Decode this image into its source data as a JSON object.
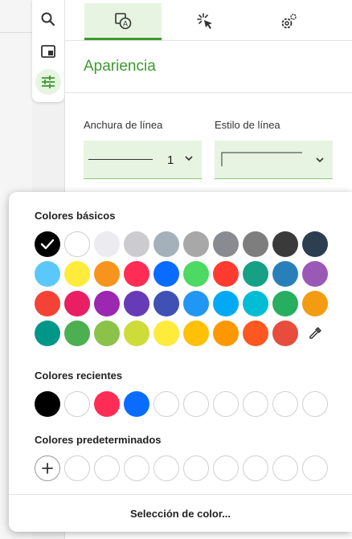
{
  "tabs": [
    {
      "name": "tab-format-icon",
      "active": true
    },
    {
      "name": "tab-interactivity-icon",
      "active": false
    },
    {
      "name": "tab-settings-icon",
      "active": false
    }
  ],
  "section_title": "Apariencia",
  "line_width": {
    "label": "Anchura de línea",
    "value": "1"
  },
  "line_style": {
    "label": "Estilo de línea"
  },
  "color_picker": {
    "basic_title": "Colores básicos",
    "recent_title": "Colores recientes",
    "preset_title": "Colores predeterminados",
    "select_label": "Selección de color...",
    "basic_colors": [
      [
        "#000000",
        "#ffffff",
        "#ebebf0",
        "#cbcbd0",
        "#a5b1ba",
        "#a8a8a8",
        "#8a8b90",
        "#7e7e7e",
        "#3a3a3a",
        "#2c3e50"
      ],
      [
        "#5ac8fa",
        "#ffeb3b",
        "#f7941d",
        "#ff2d55",
        "#0a6cff",
        "#4cd964",
        "#ff3b30",
        "#16a085",
        "#2980b9",
        "#9b59b6"
      ],
      [
        "#f44336",
        "#e91e63",
        "#9c27b0",
        "#673ab7",
        "#3f51b5",
        "#2196f3",
        "#03a9f4",
        "#00bcd4",
        "#27ae60",
        "#f39c12"
      ],
      [
        "#009688",
        "#4caf50",
        "#8bc34a",
        "#cddc39",
        "#ffeb3b",
        "#ffc107",
        "#ff9800",
        "#ff5722",
        "#e74c3c",
        "eyedropper"
      ]
    ],
    "selected_basic": "#000000",
    "recent_colors": [
      "#000000",
      "#ffffff",
      "#ff2d55",
      "#0a6cff",
      "",
      "",
      "",
      "",
      "",
      ""
    ],
    "preset_colors": [
      "add",
      "",
      "",
      "",
      "",
      "",
      "",
      "",
      "",
      ""
    ]
  }
}
